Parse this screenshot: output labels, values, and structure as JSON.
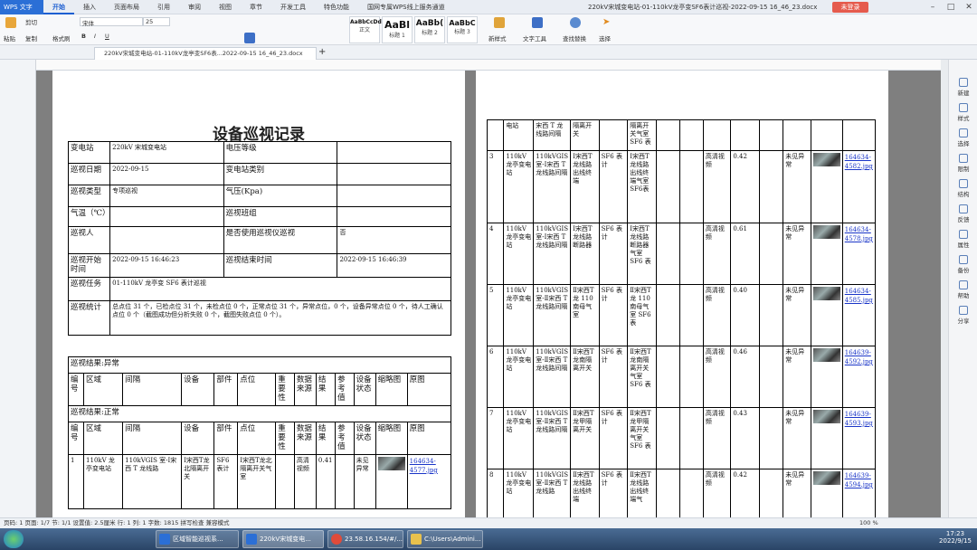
{
  "app": {
    "name": "WPS 文字",
    "title": "220kV宋城变电站-01-110kV龙亭变SF6表计巡视-2022-09-15 16_46_23.docx",
    "login": "未登录"
  },
  "menu": [
    "开始",
    "插入",
    "页面布局",
    "引用",
    "审阅",
    "视图",
    "章节",
    "开发工具",
    "特色功能",
    "国网专属WPS线上服务通道"
  ],
  "ribbon": {
    "paste": "粘贴",
    "cut": "剪切",
    "copy": "复制",
    "format_painter": "格式刷",
    "font": "宋体",
    "size": "25",
    "styles": [
      {
        "preview": "AaBbCcDd",
        "name": "正文"
      },
      {
        "preview": "AaBl",
        "name": "标题 1"
      },
      {
        "preview": "AaBb(",
        "name": "标题 2"
      },
      {
        "preview": "AaBbC",
        "name": "标题 3"
      }
    ],
    "new_style": "新样式",
    "text_tools": "文字工具",
    "find_replace": "查找替换",
    "select": "选择"
  },
  "tab": {
    "label": "220kV宋城变电站-01-110kV龙亭变SF6表...2022-09-15 16_46_23.docx"
  },
  "doc": {
    "title": "设备巡视记录",
    "info": [
      [
        "变电站",
        "220kV 宋城变电站",
        "电压等级",
        ""
      ],
      [
        "巡视日期",
        "2022-09-15",
        "变电站类别",
        ""
      ],
      [
        "巡视类型",
        "专项巡视",
        "气压(Kpa)",
        ""
      ],
      [
        "气温（℃）",
        "",
        "巡视班组",
        ""
      ],
      [
        "巡视人",
        "",
        "是否使用巡视仪巡视",
        "否"
      ],
      [
        "巡视开始时间",
        "2022-09-15 16:46:23",
        "巡视结束时间",
        "2022-09-15 16:46:39"
      ]
    ],
    "task_label": "巡视任务",
    "task_value": "01-110kV 龙亭变 SF6 表计巡视",
    "stat_label": "巡视统计",
    "stat_value": "总点位 31 个，已检点位 31 个，未检点位 0 个，正常点位 31 个，异常点位，0 个，设备异常点位 0 个，待人工确认点位 0 个（截图成功但分析失败 0 个，截图失败点位 0 个）。",
    "abnormal_title": "巡视结果:异常",
    "normal_title": "巡视结果:正常",
    "headers": [
      "编号",
      "区域",
      "间隔",
      "设备",
      "部件",
      "点位",
      "重要性",
      "数据来源",
      "结果",
      "参考值",
      "设备状态",
      "缩略图",
      "原图"
    ],
    "row1": [
      "1",
      "110kV 龙亭变电站",
      "110kVGIS 室-Ⅰ宋西 T 龙线路",
      "Ⅰ宋西T龙北隔离开关",
      "SF6 表计",
      "Ⅰ宋西T龙北隔离开关气室",
      "",
      "高清视频",
      "0.41",
      "",
      "未见异常",
      "",
      "164634-4577.jpg"
    ]
  },
  "right_rows": [
    {
      "no": "",
      "area": "电站",
      "bay": "宋西 T 龙线路间隔",
      "dev": "隔离开关",
      "part": "",
      "point": "隔离开关气室 SF6 表",
      "src": "",
      "val": "",
      "status": "",
      "img": ""
    },
    {
      "no": "3",
      "area": "110kV 龙亭变电站",
      "bay": "110kVGIS 室-Ⅰ宋西 T 龙线路间隔",
      "dev": "Ⅰ宋西T龙线路出线终端",
      "part": "SF6 表计",
      "point": "Ⅰ宋西T龙线路出线终端气室 SF6表",
      "src": "高清视频",
      "val": "0.42",
      "status": "未见异常",
      "img": "164634-4582.jpg"
    },
    {
      "no": "4",
      "area": "110kV 龙亭变电站",
      "bay": "110kVGIS 室-Ⅰ宋西 T 龙线路间隔",
      "dev": "Ⅰ宋西T龙线路断路器",
      "part": "SF6 表计",
      "point": "Ⅰ宋西T龙线路断路器气室 SF6 表",
      "src": "高清视频",
      "val": "0.61",
      "status": "未见异常",
      "img": "164634-4578.jpg"
    },
    {
      "no": "5",
      "area": "110kV 龙亭变电站",
      "bay": "110kVGIS 室-Ⅱ宋西 T 龙线路间隔",
      "dev": "Ⅱ宋西T龙 110南母气室",
      "part": "SF6 表计",
      "point": "Ⅱ宋西T龙 110南母气室 SF6 表",
      "src": "高清视频",
      "val": "0.40",
      "status": "未见异常",
      "img": "164634-4585.jpg"
    },
    {
      "no": "6",
      "area": "110kV 龙亭变电站",
      "bay": "110kVGIS 室-Ⅱ宋西 T 龙线路间隔",
      "dev": "Ⅱ宋西T龙南隔离开关",
      "part": "SF6 表计",
      "point": "Ⅱ宋西T龙南隔离开关气室 SF6 表",
      "src": "高清视频",
      "val": "0.46",
      "status": "未见异常",
      "img": "164639-4592.jpg"
    },
    {
      "no": "7",
      "area": "110kV 龙亭变电站",
      "bay": "110kVGIS 室-Ⅱ宋西 T 龙线路间隔",
      "dev": "Ⅱ宋西T龙甲隔离开关",
      "part": "SF6 表计",
      "point": "Ⅱ宋西T龙甲隔离开关气室 SF6 表",
      "src": "高清视频",
      "val": "0.43",
      "status": "未见异常",
      "img": "164639-4593.jpg"
    },
    {
      "no": "8",
      "area": "110kV 龙亭变电站",
      "bay": "110kVGIS 室-Ⅱ宋西 T 龙线路",
      "dev": "Ⅱ宋西T龙线路出线终端",
      "part": "SF6 表计",
      "point": "Ⅱ宋西T龙线路出线终端气",
      "src": "高清视频",
      "val": "0.42",
      "status": "未见异常",
      "img": "164639-4594.jpg"
    }
  ],
  "sidebar": [
    "新建",
    "样式",
    "选择",
    "限制",
    "结构",
    "反馈",
    "属性",
    "备份",
    "帮助",
    "分享"
  ],
  "status": {
    "left": "页码: 1  页面: 1/7  节: 1/1  设置值: 2.5厘米  行: 1  列: 1  字数: 1815  拼写检查  兼容模式",
    "zoom": "100 %"
  },
  "taskbar": {
    "items": [
      "区域智能巡视系...",
      "220kV宋城变电...",
      "23.58.16.154/#/...",
      "C:\\Users\\Admini..."
    ],
    "time": "17:23",
    "date": "2022/9/15"
  }
}
